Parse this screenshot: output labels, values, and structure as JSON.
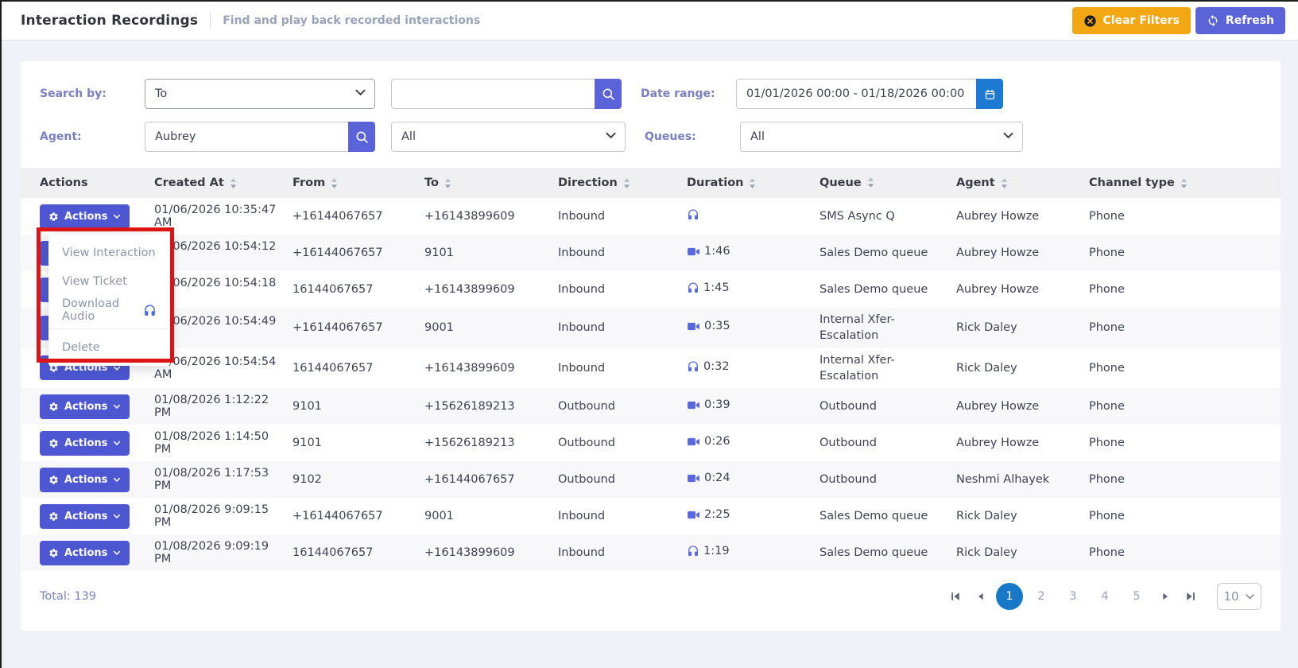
{
  "header": {
    "title": "Interaction Recordings",
    "subtitle": "Find and play back recorded interactions",
    "clear_filters_label": "Clear Filters",
    "refresh_label": "Refresh"
  },
  "filters": {
    "search_by_label": "Search by:",
    "search_by_value": "To",
    "search_value": "",
    "date_range_label": "Date range:",
    "date_range_value": "01/01/2026 00:00 - 01/18/2026 00:00",
    "agent_label": "Agent:",
    "agent_value": "Aubrey",
    "agent_filter_value": "All",
    "queues_label": "Queues:",
    "queues_value": "All"
  },
  "table": {
    "actions_button_label": "Actions",
    "columns": [
      "Actions",
      "Created At",
      "From",
      "To",
      "Direction",
      "Duration",
      "Queue",
      "Agent",
      "Channel type"
    ],
    "rows": [
      {
        "created_at": "01/06/2026 10:35:47 AM",
        "from": "+16144067657",
        "to": "+16143899609",
        "direction": "Inbound",
        "duration": "",
        "duration_icon": "headphones",
        "queue": "SMS Async Q",
        "agent": "Aubrey Howze",
        "channel": "Phone"
      },
      {
        "created_at": "01/06/2026 10:54:12 AM",
        "from": "+16144067657",
        "to": "9101",
        "direction": "Inbound",
        "duration": "1:46",
        "duration_icon": "video",
        "queue": "Sales Demo queue",
        "agent": "Aubrey Howze",
        "channel": "Phone"
      },
      {
        "created_at": "01/06/2026 10:54:18 AM",
        "from": "16144067657",
        "to": "+16143899609",
        "direction": "Inbound",
        "duration": "1:45",
        "duration_icon": "headphones",
        "queue": "Sales Demo queue",
        "agent": "Aubrey Howze",
        "channel": "Phone"
      },
      {
        "created_at": "01/06/2026 10:54:49 AM",
        "from": "+16144067657",
        "to": "9001",
        "direction": "Inbound",
        "duration": "0:35",
        "duration_icon": "video",
        "queue": "Internal Xfer-Escalation",
        "agent": "Rick Daley",
        "channel": "Phone"
      },
      {
        "created_at": "01/06/2026 10:54:54 AM",
        "from": "16144067657",
        "to": "+16143899609",
        "direction": "Inbound",
        "duration": "0:32",
        "duration_icon": "headphones",
        "queue": "Internal Xfer-Escalation",
        "agent": "Rick Daley",
        "channel": "Phone"
      },
      {
        "created_at": "01/08/2026 1:12:22 PM",
        "from": "9101",
        "to": "+15626189213",
        "direction": "Outbound",
        "duration": "0:39",
        "duration_icon": "video",
        "queue": "Outbound",
        "agent": "Aubrey Howze",
        "channel": "Phone"
      },
      {
        "created_at": "01/08/2026 1:14:50 PM",
        "from": "9101",
        "to": "+15626189213",
        "direction": "Outbound",
        "duration": "0:26",
        "duration_icon": "video",
        "queue": "Outbound",
        "agent": "Aubrey Howze",
        "channel": "Phone"
      },
      {
        "created_at": "01/08/2026 1:17:53 PM",
        "from": "9102",
        "to": "+16144067657",
        "direction": "Outbound",
        "duration": "0:24",
        "duration_icon": "video",
        "queue": "Outbound",
        "agent": "Neshmi Alhayek",
        "channel": "Phone"
      },
      {
        "created_at": "01/08/2026 9:09:15 PM",
        "from": "+16144067657",
        "to": "9001",
        "direction": "Inbound",
        "duration": "2:25",
        "duration_icon": "video",
        "queue": "Sales Demo queue",
        "agent": "Rick Daley",
        "channel": "Phone"
      },
      {
        "created_at": "01/08/2026 9:09:19 PM",
        "from": "16144067657",
        "to": "+16143899609",
        "direction": "Inbound",
        "duration": "1:19",
        "duration_icon": "headphones",
        "queue": "Sales Demo queue",
        "agent": "Rick Daley",
        "channel": "Phone"
      }
    ]
  },
  "menu": {
    "items": [
      "View Interaction",
      "View Ticket",
      "Download Audio",
      "Delete"
    ]
  },
  "footer": {
    "total_label": "Total: 139",
    "pages": [
      "1",
      "2",
      "3",
      "4",
      "5"
    ],
    "active_page": "1",
    "page_size": "10"
  },
  "icons": {
    "clear_filters": "circle-x-icon",
    "refresh": "refresh-icon",
    "search": "search-icon",
    "calendar": "calendar-icon",
    "actions": "gear-icon",
    "duration_audio": "headphones-icon",
    "duration_video": "video-camera-icon"
  },
  "colors": {
    "accent_indigo": "#4d57d2",
    "button_indigo": "#5b63d8",
    "warning_orange": "#f3a712",
    "calendar_blue": "#1d7ad3",
    "pagination_active_blue": "#1878c8",
    "label_periwinkle": "#7b80c3",
    "annotation_red": "#dd1414"
  }
}
